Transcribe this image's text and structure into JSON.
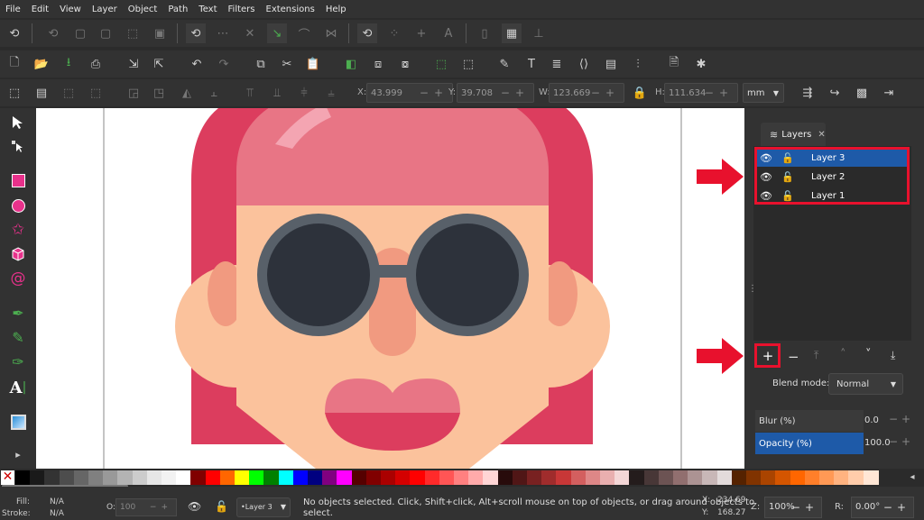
{
  "menu": [
    "File",
    "Edit",
    "View",
    "Layer",
    "Object",
    "Path",
    "Text",
    "Filters",
    "Extensions",
    "Help"
  ],
  "tool_controls": {
    "x_label": "X:",
    "x_value": "43.999",
    "y_label": "Y:",
    "y_value": "39.708",
    "w_label": "W:",
    "w_value": "123.669",
    "h_label": "H:",
    "h_value": "111.634",
    "unit": "mm"
  },
  "layers_panel": {
    "tab_label": "Layers",
    "layers": [
      "Layer 3",
      "Layer 2",
      "Layer 1"
    ],
    "selected_layer": "Layer 3",
    "blend_label": "Blend mode:",
    "blend_value": "Normal",
    "blur_label": "Blur (%)",
    "blur_value": "0.0",
    "opacity_label": "Opacity (%)",
    "opacity_value": "100.0"
  },
  "status": {
    "fill_label": "Fill:",
    "fill_value": "N/A",
    "stroke_label": "Stroke:",
    "stroke_value": "N/A",
    "opacity_label": "O:",
    "opacity_value": "100",
    "current_layer": "•Layer 3",
    "message_line1": "No objects selected. Click, Shift+click, Alt+scroll mouse on top of objects, or drag around objects to",
    "message_line2": "select.",
    "x_label": "X:",
    "x_value": "234.69",
    "y_label": "Y:",
    "y_value": "168.27",
    "zoom_label": "Z:",
    "zoom_value": "100%",
    "rotate_label": "R:",
    "rotate_value": "0.00°"
  },
  "colors": {
    "accent_red": "#e8112d",
    "selected_blue": "#1e5aa8",
    "hair": "#dc3d5e",
    "hair_top": "#e87585",
    "skin": "#fbc29c",
    "glasses_frame": "#586069",
    "lens": "#2d323b",
    "nose": "#f19a80",
    "lips_top": "#e87585",
    "lips_bottom": "#dc3d5e"
  }
}
